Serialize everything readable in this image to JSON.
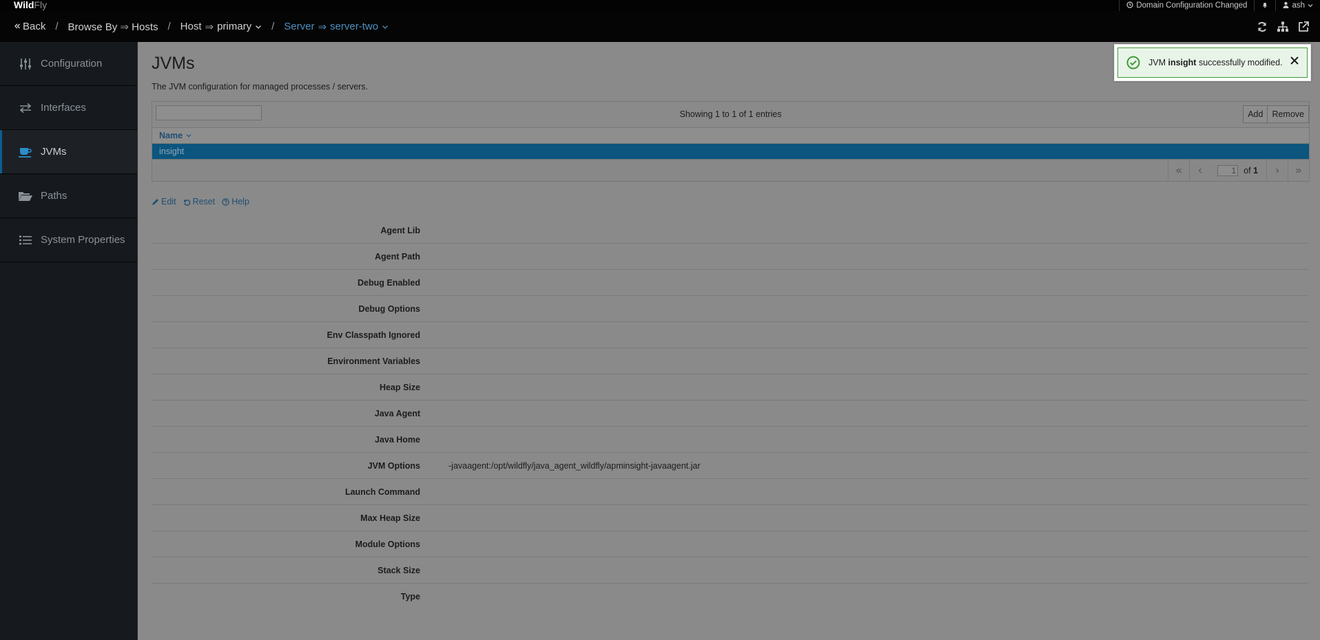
{
  "topbar": {
    "brand_bold": "Wild",
    "brand_light": "Fly",
    "config_changed": "Domain Configuration Changed",
    "user": "ash"
  },
  "breadcrumb": {
    "back": "Back",
    "browse_by": "Browse By",
    "browse_target": "Hosts",
    "host_label": "Host",
    "host_value": "primary",
    "server_label": "Server",
    "server_value": "server-two",
    "arrow": "⇒",
    "slash": "/"
  },
  "sidebar": {
    "items": [
      {
        "label": "Configuration",
        "icon": "sliders-icon"
      },
      {
        "label": "Interfaces",
        "icon": "exchange-icon"
      },
      {
        "label": "JVMs",
        "icon": "coffee-icon"
      },
      {
        "label": "Paths",
        "icon": "folder-open-icon"
      },
      {
        "label": "System Properties",
        "icon": "list-icon"
      }
    ],
    "active": "JVMs"
  },
  "main": {
    "title": "JVMs",
    "subtitle": "The JVM configuration for managed processes / servers."
  },
  "table": {
    "filter_value": "",
    "entries": "Showing 1 to 1 of 1 entries",
    "add": "Add",
    "remove": "Remove",
    "column_name": "Name",
    "rows": [
      "insight"
    ],
    "page": "1",
    "of_label": "of",
    "total_pages": "1"
  },
  "actions": {
    "edit": "Edit",
    "reset": "Reset",
    "help": "Help"
  },
  "attributes": [
    {
      "key": "Agent Lib",
      "value": ""
    },
    {
      "key": "Agent Path",
      "value": ""
    },
    {
      "key": "Debug Enabled",
      "value": ""
    },
    {
      "key": "Debug Options",
      "value": ""
    },
    {
      "key": "Env Classpath Ignored",
      "value": ""
    },
    {
      "key": "Environment Variables",
      "value": ""
    },
    {
      "key": "Heap Size",
      "value": ""
    },
    {
      "key": "Java Agent",
      "value": ""
    },
    {
      "key": "Java Home",
      "value": ""
    },
    {
      "key": "JVM Options",
      "value": "-javaagent:/opt/wildfly/java_agent_wildfly/apminsight-javaagent.jar"
    },
    {
      "key": "Launch Command",
      "value": ""
    },
    {
      "key": "Max Heap Size",
      "value": ""
    },
    {
      "key": "Module Options",
      "value": ""
    },
    {
      "key": "Stack Size",
      "value": ""
    },
    {
      "key": "Type",
      "value": ""
    }
  ],
  "toast": {
    "prefix": "JVM",
    "name": "insight",
    "suffix": "successfully modified."
  },
  "colors": {
    "selected_row": "#0c557e",
    "link": "#1f4e73",
    "success": "#3f9c35",
    "sidebar_bg": "#161a1e"
  }
}
